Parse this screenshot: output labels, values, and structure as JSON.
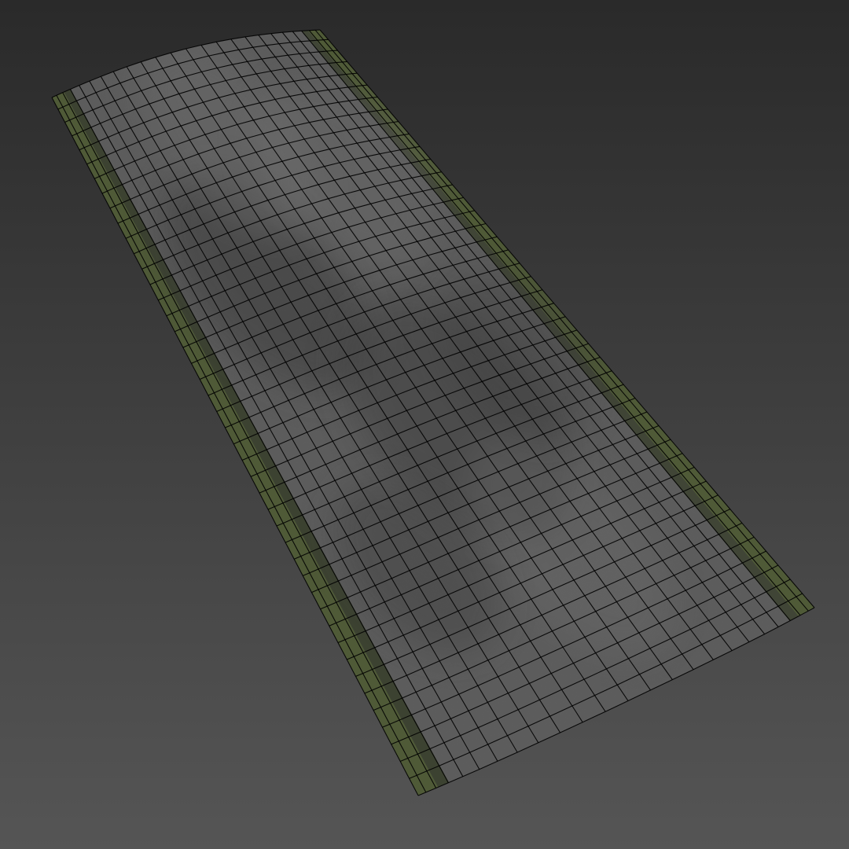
{
  "viewport": {
    "background_top": "#2a2a2a",
    "background_bottom": "#555555"
  },
  "road": {
    "asphalt_color": "#5b5b5b",
    "asphalt_dark": "#3e3e3e",
    "asphalt_light": "#6e6e6e",
    "verge_color": "#4f5a37",
    "verge_dark": "#353c27",
    "wire_color": "#000000",
    "grid_columns": 24,
    "grid_rows": 44
  }
}
